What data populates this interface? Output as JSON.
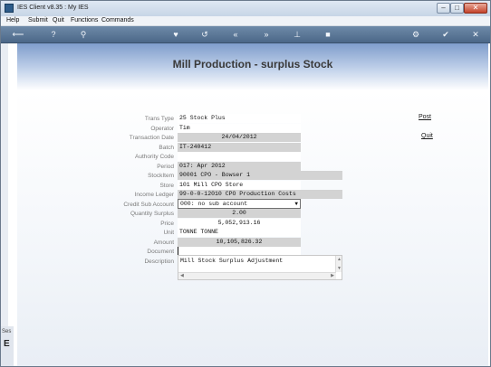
{
  "window": {
    "title": "IES Client v8.35 : My IES",
    "controls": {
      "minimize": "–",
      "maximize": "□",
      "close": "✕"
    }
  },
  "menu": [
    "Help",
    "Submit",
    "Quit",
    "Functions",
    "Commands"
  ],
  "toolbar": {
    "icons": [
      "back-arrow-icon",
      "help-icon",
      "search-icon",
      "heart-icon",
      "refresh-icon",
      "rewind-icon",
      "forward-icon",
      "pin-icon",
      "stop-icon",
      "settings-icon",
      "ok-icon",
      "close-icon"
    ],
    "glyphs": [
      "⟵",
      "?",
      "⚲",
      "♥",
      "↺",
      "«",
      "»",
      "⊥",
      "■",
      "⚙",
      "✔",
      "✕"
    ]
  },
  "page": {
    "title": "Mill Production - surplus Stock"
  },
  "form": {
    "labels": {
      "trans_type": "Trans Type",
      "operator": "Operator",
      "transaction_date": "Transaction Date",
      "batch": "Batch",
      "authority_code": "Authority Code",
      "period": "Period",
      "stockitem": "StockItem",
      "store": "Store",
      "income_ledger": "Income Ledger",
      "credit_sub_account": "Credit Sub Account",
      "quantity_surplus": "Quantity Surplus",
      "price": "Price",
      "unit": "Unit",
      "amount": "Amount",
      "document": "Document",
      "description": "Description"
    },
    "values": {
      "trans_type": "25 Stock Plus",
      "operator": "Tim",
      "transaction_date": "24/04/2012",
      "batch": "IT-240412",
      "authority_code": "",
      "period": "017: Apr 2012",
      "stockitem": "90001 CPO - Bowser 1",
      "store": "101 Mill CPO Store",
      "income_ledger": "99-0-0-12010 CPO Production Costs",
      "credit_sub_account": "000: no sub account",
      "quantity_surplus": "2.00",
      "price": "5,052,913.16",
      "unit": "TONNE TONNE",
      "amount": "10,105,826.32",
      "document": "",
      "description": "Mill Stock Surplus Adjustment"
    }
  },
  "actions": {
    "post": "Post",
    "quit": "Quit"
  },
  "side": {
    "tab_text": "Ses",
    "tab_letter": "E"
  }
}
